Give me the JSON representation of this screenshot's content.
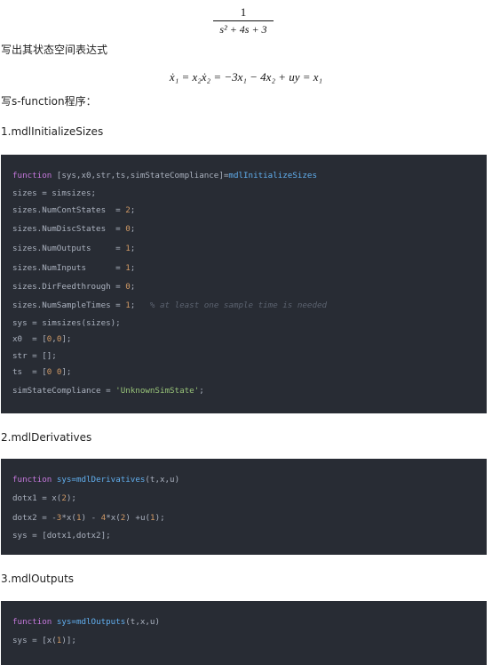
{
  "transfer_function": {
    "numerator": "1",
    "denominator": "s² + 4s + 3"
  },
  "heading_state_space": "写出其状态空间表达式",
  "state_space_equation": {
    "text": "ẋ₁ = x₂ẋ₂ = −3x₁ − 4x₂ + uy = x₁"
  },
  "heading_program": "写s-function程序：",
  "sections": [
    {
      "title": "1.mdlInitializeSizes",
      "code": [
        [
          [
            "kw",
            "function"
          ],
          [
            "p",
            " [sys,x0,str,ts,simStateCompliance]="
          ],
          [
            "fn",
            "mdlInitializeSizes"
          ]
        ],
        [
          [
            "p",
            "sizes = simsizes;"
          ]
        ],
        [
          [
            "p",
            "sizes.NumContStates  = "
          ],
          [
            "nm",
            "2"
          ],
          [
            "p",
            ";"
          ]
        ],
        [
          [
            "p",
            "sizes.NumDiscStates  = "
          ],
          [
            "nm",
            "0"
          ],
          [
            "p",
            ";"
          ]
        ],
        [
          [
            "p",
            "sizes.NumOutputs     = "
          ],
          [
            "nm",
            "1"
          ],
          [
            "p",
            ";"
          ]
        ],
        [
          [
            "p",
            "sizes.NumInputs      = "
          ],
          [
            "nm",
            "1"
          ],
          [
            "p",
            ";"
          ]
        ],
        [
          [
            "p",
            "sizes.DirFeedthrough = "
          ],
          [
            "nm",
            "0"
          ],
          [
            "p",
            ";"
          ]
        ],
        [
          [
            "p",
            "sizes.NumSampleTimes = "
          ],
          [
            "nm",
            "1"
          ],
          [
            "p",
            ";   "
          ],
          [
            "cm",
            "% at least one sample time is needed"
          ]
        ],
        [
          [
            "p",
            "sys = simsizes(sizes);"
          ]
        ],
        [
          [
            "p",
            "x0  = ["
          ],
          [
            "nm",
            "0"
          ],
          [
            "p",
            ","
          ],
          [
            "nm",
            "0"
          ],
          [
            "p",
            "];"
          ]
        ],
        [
          [
            "p",
            "str = [];"
          ]
        ],
        [
          [
            "p",
            "ts  = ["
          ],
          [
            "nm",
            "0"
          ],
          [
            "p",
            " "
          ],
          [
            "nm",
            "0"
          ],
          [
            "p",
            "];"
          ]
        ],
        [
          [
            "p",
            "simStateCompliance = "
          ],
          [
            "st",
            "'UnknownSimState'"
          ],
          [
            "p",
            ";"
          ]
        ]
      ]
    },
    {
      "title": "2.mdlDerivatives",
      "code": [
        [
          [
            "kw",
            "function"
          ],
          [
            "p",
            " "
          ],
          [
            "fn",
            "sys=mdlDerivatives"
          ],
          [
            "p",
            "(t,x,u)"
          ]
        ],
        [
          [
            "p",
            "dotx1 = x("
          ],
          [
            "nm",
            "2"
          ],
          [
            "p",
            ");"
          ]
        ],
        [
          [
            "p",
            "dotx2 = -"
          ],
          [
            "nm",
            "3"
          ],
          [
            "p",
            "*x("
          ],
          [
            "nm",
            "1"
          ],
          [
            "p",
            ") - "
          ],
          [
            "nm",
            "4"
          ],
          [
            "p",
            "*x("
          ],
          [
            "nm",
            "2"
          ],
          [
            "p",
            ") +u("
          ],
          [
            "nm",
            "1"
          ],
          [
            "p",
            ");"
          ]
        ],
        [
          [
            "p",
            "sys = [dotx1,dotx2];"
          ]
        ]
      ]
    },
    {
      "title": "3.mdlOutputs",
      "code": [
        [
          [
            "kw",
            "function"
          ],
          [
            "p",
            " "
          ],
          [
            "fn",
            "sys=mdlOutputs"
          ],
          [
            "p",
            "(t,x,u)"
          ]
        ],
        [
          [
            "p",
            "sys = [x("
          ],
          [
            "nm",
            "1"
          ],
          [
            "p",
            ")];"
          ]
        ]
      ]
    }
  ]
}
